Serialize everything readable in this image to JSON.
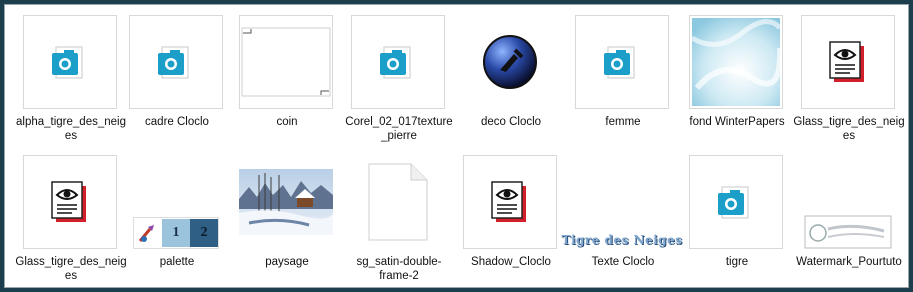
{
  "files": [
    {
      "name": "alpha_tigre_des_neiges",
      "icon": "photo-file-icon"
    },
    {
      "name": "cadre Cloclo",
      "icon": "photo-file-icon"
    },
    {
      "name": "coin",
      "icon": "corner-thumbnail"
    },
    {
      "name": "Corel_02_017texture_pierre",
      "icon": "photo-file-icon"
    },
    {
      "name": "deco Cloclo",
      "icon": "deco-ball-icon"
    },
    {
      "name": "femme",
      "icon": "photo-file-icon"
    },
    {
      "name": "fond WinterPapers",
      "icon": "snow-texture-thumbnail"
    },
    {
      "name": "Glass_tigre_des_neiges",
      "icon": "eye-document-icon"
    },
    {
      "name": "Glass_tigre_des_neiges",
      "icon": "eye-document-icon"
    },
    {
      "name": "palette",
      "icon": "palette-thumbnail",
      "swatches": [
        "1",
        "2"
      ]
    },
    {
      "name": "paysage",
      "icon": "winter-landscape-thumbnail"
    },
    {
      "name": "sg_satin-double-frame-2",
      "icon": "blank-file-icon"
    },
    {
      "name": "Shadow_Cloclo",
      "icon": "eye-document-icon"
    },
    {
      "name": "Texte Cloclo",
      "icon": "text-thumbnail",
      "text": "Tigre des Neiges"
    },
    {
      "name": "tigre",
      "icon": "photo-file-icon"
    },
    {
      "name": "Watermark_Pourtuto",
      "icon": "watermark-thumbnail"
    }
  ],
  "colors": {
    "accent": "#1b9fc9",
    "frame": "#1d3e4d",
    "eye_red": "#d21f2b"
  }
}
